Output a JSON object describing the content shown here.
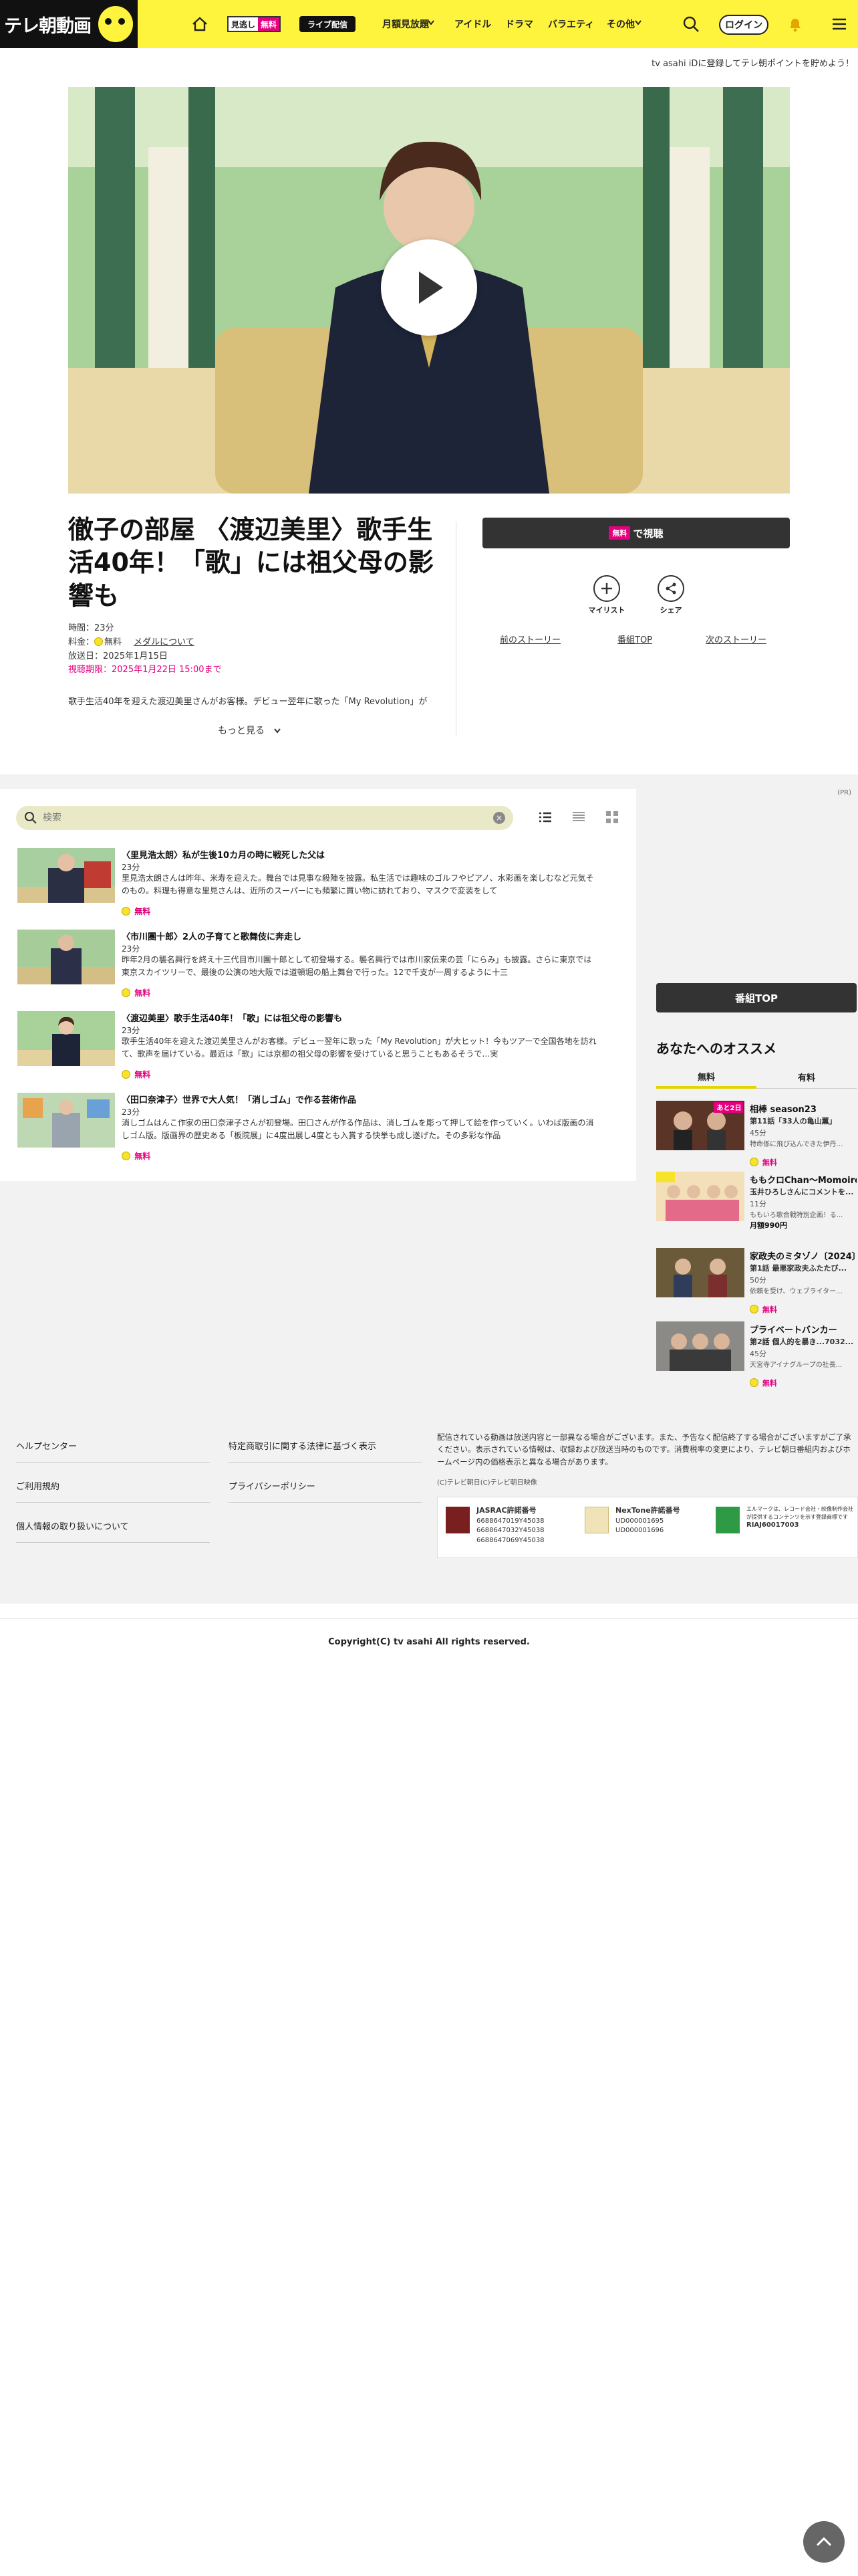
{
  "header": {
    "logo_text": "テレ朝動画",
    "pill1_a": "見逃し",
    "pill1_b": "無料",
    "pill2": "ライブ配信",
    "nav": [
      "月額見放題",
      "アイドル",
      "ドラマ",
      "バラエティ",
      "その他"
    ],
    "login": "ログイン"
  },
  "promo_text": "tv asahi iDに登録してテレ朝ポイントを貯めよう！",
  "episode": {
    "title": "徹子の部屋 〈渡辺美里〉歌手生活40年！「歌」には祖父母の影響も",
    "duration": "時間：23分",
    "price_label": "料金：",
    "price_value": "無料",
    "member_link": "メダルについて",
    "aired": "放送日：2025年1月15日",
    "deadline": "視聴期限：2025年1月22日 15:00まで",
    "description": "歌手生活40年を迎えた渡辺美里さんがお客様。デビュー翌年に歌った「My Revolution」が",
    "more": "もっと見る"
  },
  "actions": {
    "watch_badge": "無料",
    "watch_label": "で視聴",
    "mylist": "マイリスト",
    "share": "シェア",
    "prev": "前のストーリー",
    "top": "番組TOP",
    "next": "次のストーリー"
  },
  "ad_note": "(PR)",
  "search": {
    "placeholder": "検索"
  },
  "episodes": [
    {
      "title": "〈里見浩太朗〉私が生後10カ月の時に戦死した父は",
      "duration": "23分",
      "desc": "里見浩太朗さんは昨年、米寿を迎えた。舞台では見事な殺陣を披露。私生活では趣味のゴルフやピアノ、水彩画を楽しむなど元気そのもの。料理も得意な里見さんは、近所のスーパーにも頻繁に買い物に訪れており、マスクで変装をして",
      "free": "無料"
    },
    {
      "title": "〈市川團十郎〉2人の子育てと歌舞伎に奔走し",
      "duration": "23分",
      "desc": "昨年2月の襲名興行を終え十三代目市川團十郎として初登場する。襲名興行では市川家伝来の芸「にらみ」も披露。さらに東京では東京スカイツリーで、最後の公演の地大阪では道頓堀の船上舞台で行った。12で千支が一周するように十三",
      "free": "無料"
    },
    {
      "title": "〈渡辺美里〉歌手生活40年！「歌」には祖父母の影響も",
      "duration": "23分",
      "desc": "歌手生活40年を迎えた渡辺美里さんがお客様。デビュー翌年に歌った「My Revolution」が大ヒット！今もツアーで全国各地を訪れて、歌声を届けている。最近は「歌」には京都の祖父母の影響を受けていると思うこともあるそうで…実",
      "free": "無料"
    },
    {
      "title": "〈田口奈津子〉世界で大人気！「消しゴム」で作る芸術作品",
      "duration": "23分",
      "desc": "消しゴムはんこ作家の田口奈津子さんが初登場。田口さんが作る作品は、消しゴムを彫って押して絵を作っていく。いわば版画の消しゴム版。版画界の歴史ある「板院展」に4度出展し4度とも入賞する快挙も成し遂げた。その多彩な作品",
      "free": "無料"
    }
  ],
  "sidebar": {
    "program_top": "番組TOP",
    "rec_title": "あなたへのオススメ",
    "tabs": [
      "無料",
      "有料"
    ],
    "items": [
      {
        "title": "相棒 season23",
        "sub": "第11話「33人の亀山薫」",
        "dur": "45分",
        "extra": "特命係に飛び込んできた伊丹…",
        "free": "無料",
        "badge": "あと2日"
      },
      {
        "title": "ももクロChan～Momoiro...",
        "sub": "玉井ひろしさんにコメントを...",
        "dur": "11分",
        "extra": "ももいろ歌合戦特別企画！る...",
        "free": "月額990円",
        "badge": ""
      },
      {
        "title": "家政夫のミタゾノ〔2024〕",
        "sub": "第1話 最悪家政夫ふたたび...",
        "dur": "50分",
        "extra": "依頼を受け、ウェブライター...",
        "free": "無料",
        "badge": ""
      },
      {
        "title": "プライベートバンカー",
        "sub": "第2話 個人的を暴き...7032...",
        "dur": "45分",
        "extra": "天宮寺アイナグループの社長...",
        "free": "無料",
        "badge": ""
      }
    ]
  },
  "footer": {
    "links_left": [
      "ヘルプセンター",
      "ご利用規約",
      "個人情報の取り扱いについて"
    ],
    "links_right": [
      "特定商取引に関する法律に基づく表示",
      "プライバシーポリシー"
    ],
    "note": "配信されている動画は放送内容と一部異なる場合がございます。また、予告なく配信終了する場合がございますがご了承ください。表示されている情報は、収録および放送当時のものです。消費税率の変更により、テレビ朝日番組内およびホームページ内の価格表示と異なる場合があります。",
    "copyright_small": "(C)テレビ朝日(C)テレビ朝日映像",
    "jasrac_label": "JASRAC許諾番号",
    "jasrac_nums": [
      "6688647019Y45038",
      "6688647032Y45038",
      "6688647069Y45038"
    ],
    "nextone_label": "NexTone許諾番号",
    "nextone_nums": [
      "UD000001695",
      "UD000001696"
    ],
    "lmark_text": "エルマークは、レコード会社・映像制作会社が提供するコンテンツを示す登録商標です",
    "lmark_num": "RIAJ60017003",
    "copyright": "Copyright(C) tv asahi All rights reserved."
  }
}
